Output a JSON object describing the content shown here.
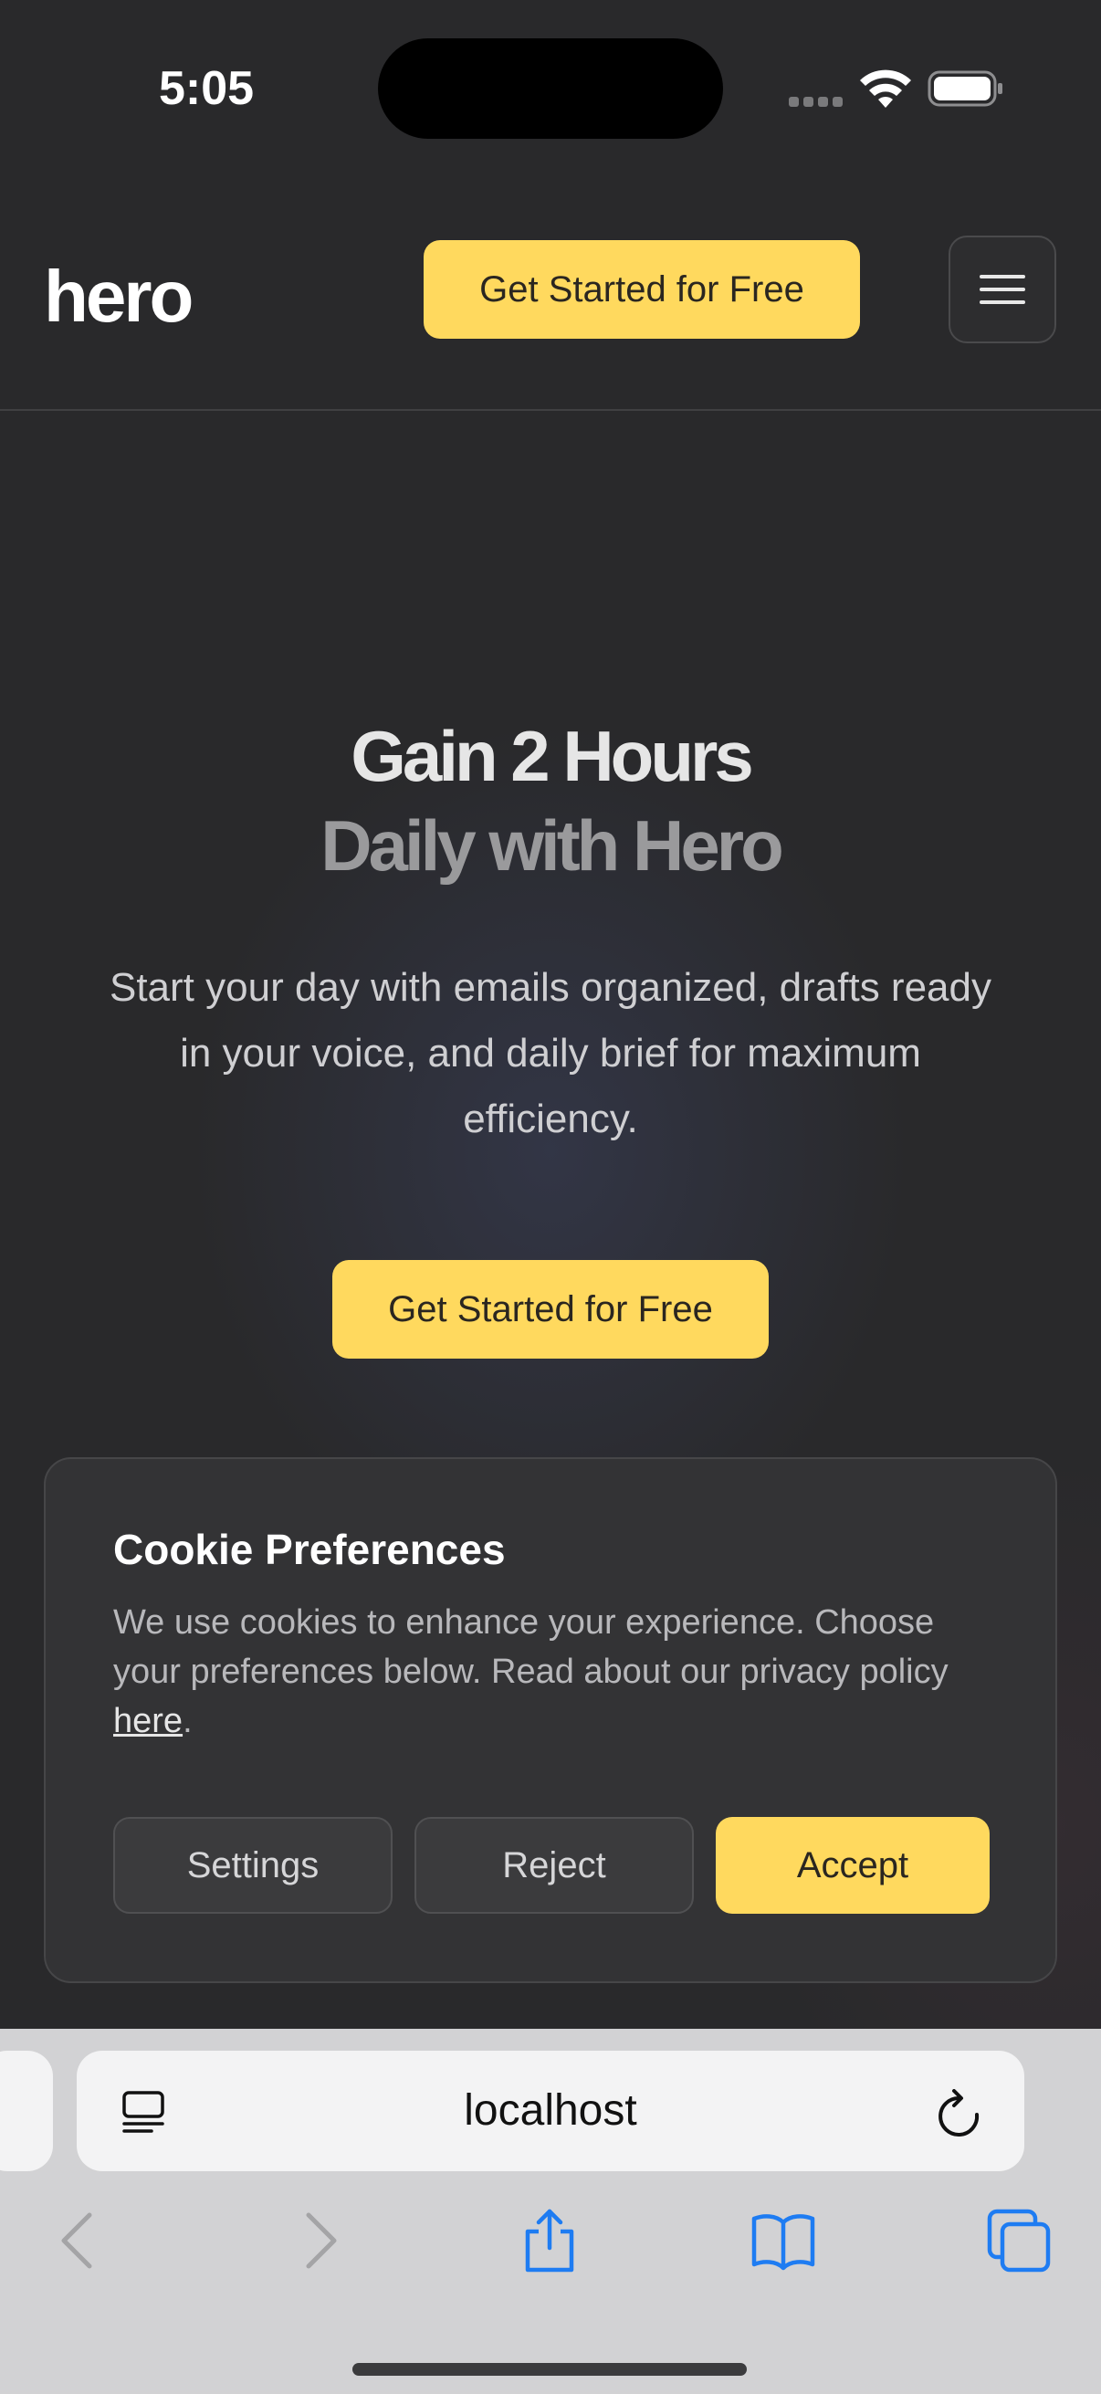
{
  "status_bar": {
    "time": "5:05"
  },
  "header": {
    "logo": "hero",
    "cta_label": "Get Started for Free"
  },
  "hero": {
    "title_line1": "Gain 2 Hours",
    "title_line2": "Daily with Hero",
    "subtitle": "Start your day with emails organized, drafts ready in your voice, and daily brief for maximum efficiency.",
    "cta_label": "Get Started for Free"
  },
  "cookie_banner": {
    "title": "Cookie Preferences",
    "text": "We use cookies to enhance your experience. Choose your preferences below. Read about our privacy policy ",
    "link_label": "here",
    "text_end": ".",
    "settings_label": "Settings",
    "reject_label": "Reject",
    "accept_label": "Accept"
  },
  "browser": {
    "url": "localhost",
    "icons": [
      "page-menu-icon",
      "reload-icon",
      "back-icon",
      "forward-icon",
      "share-icon",
      "bookmarks-icon",
      "tabs-icon"
    ]
  },
  "colors": {
    "background": "#29292b",
    "accent": "#ffd95e",
    "browser_icon": "#1e7cf2"
  }
}
